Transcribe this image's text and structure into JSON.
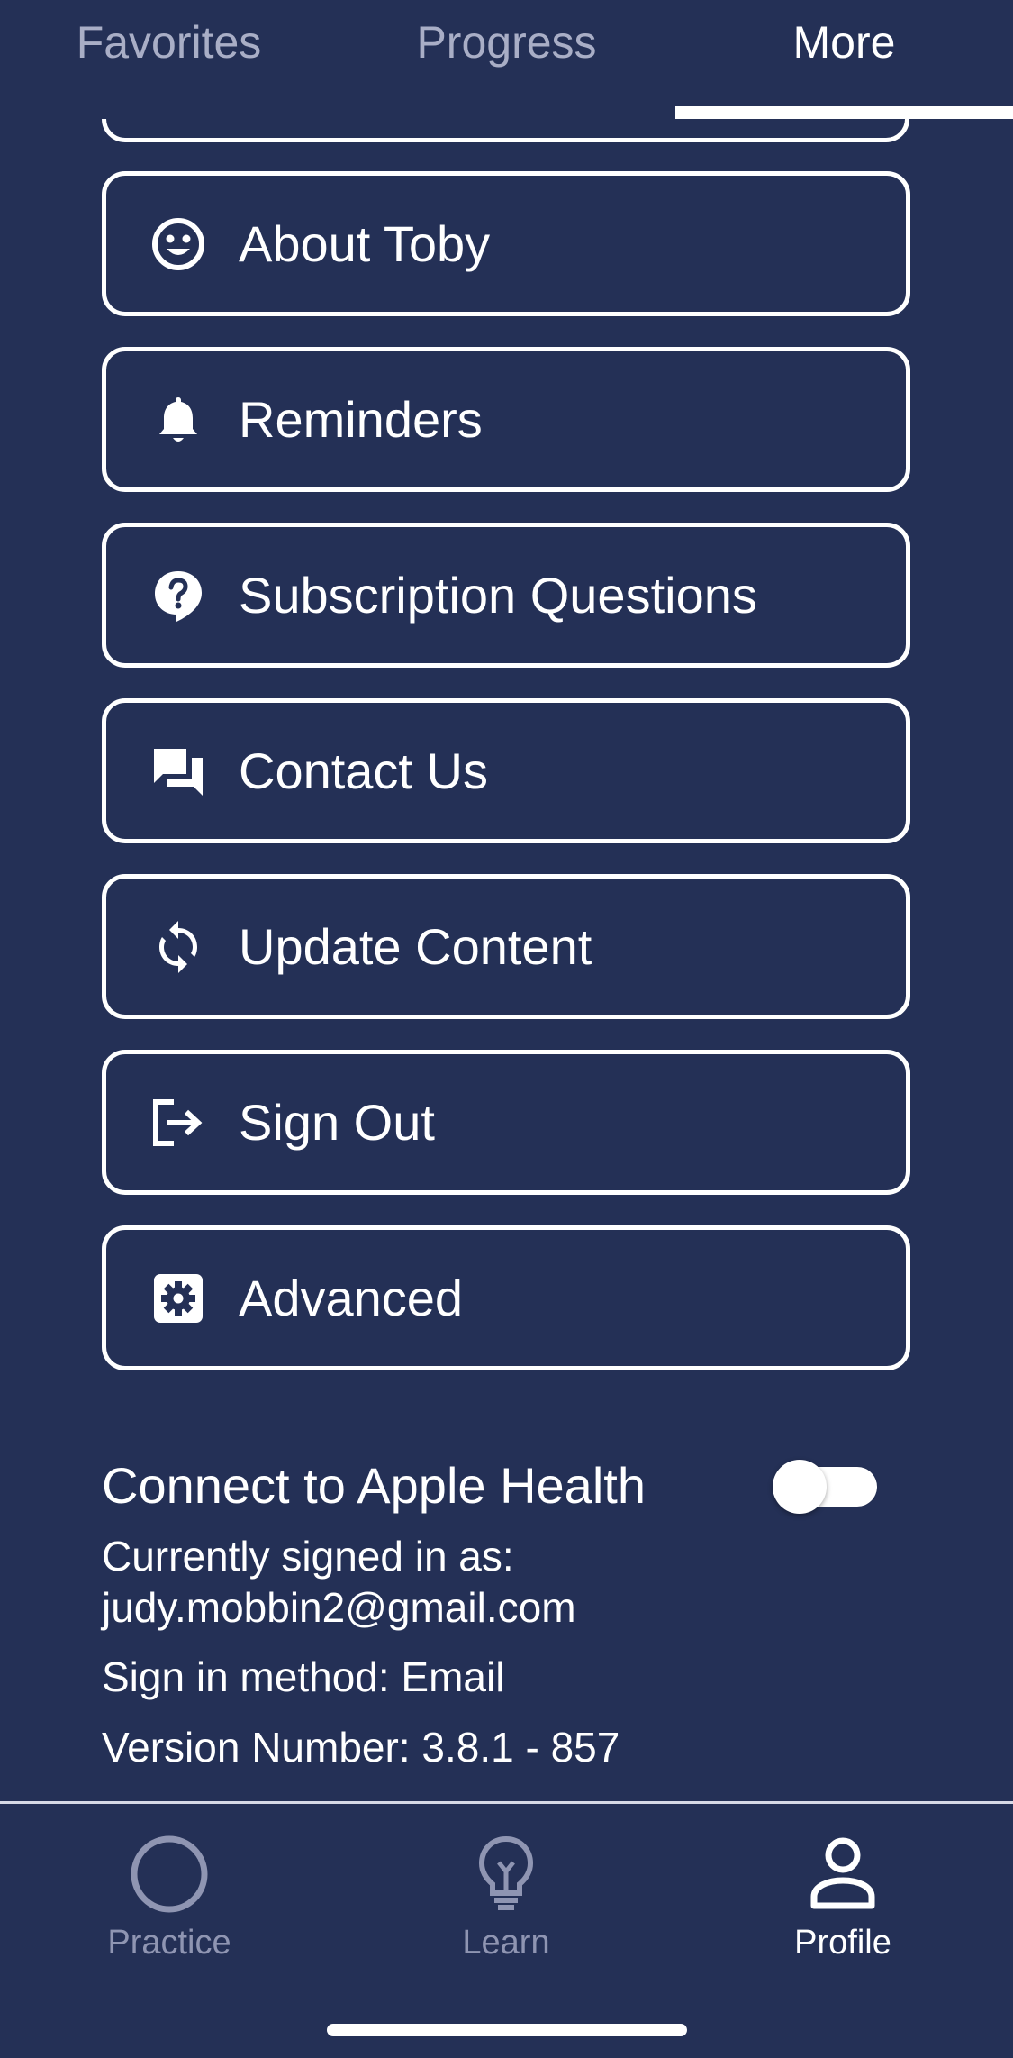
{
  "tabs": {
    "favorites": "Favorites",
    "progress": "Progress",
    "more": "More"
  },
  "menu": {
    "items": [
      {
        "label": "About Toby",
        "icon": "smiley-icon"
      },
      {
        "label": "Reminders",
        "icon": "bell-icon"
      },
      {
        "label": "Subscription Questions",
        "icon": "question-bubble-icon"
      },
      {
        "label": "Contact Us",
        "icon": "chat-bubbles-icon"
      },
      {
        "label": "Update Content",
        "icon": "refresh-icon"
      },
      {
        "label": "Sign Out",
        "icon": "sign-out-icon"
      },
      {
        "label": "Advanced",
        "icon": "gear-icon"
      }
    ]
  },
  "health": {
    "label": "Connect to Apple Health",
    "enabled": false
  },
  "account": {
    "signed_in_label": "Currently signed in as:",
    "email": "judy.mobbin2@gmail.com",
    "method": "Sign in method: Email",
    "version": "Version Number: 3.8.1 - 857"
  },
  "bottom_nav": {
    "practice": "Practice",
    "learn": "Learn",
    "profile": "Profile"
  },
  "colors": {
    "background": "#243056",
    "active_text": "#ffffff",
    "inactive_text": "#a9aec6"
  }
}
